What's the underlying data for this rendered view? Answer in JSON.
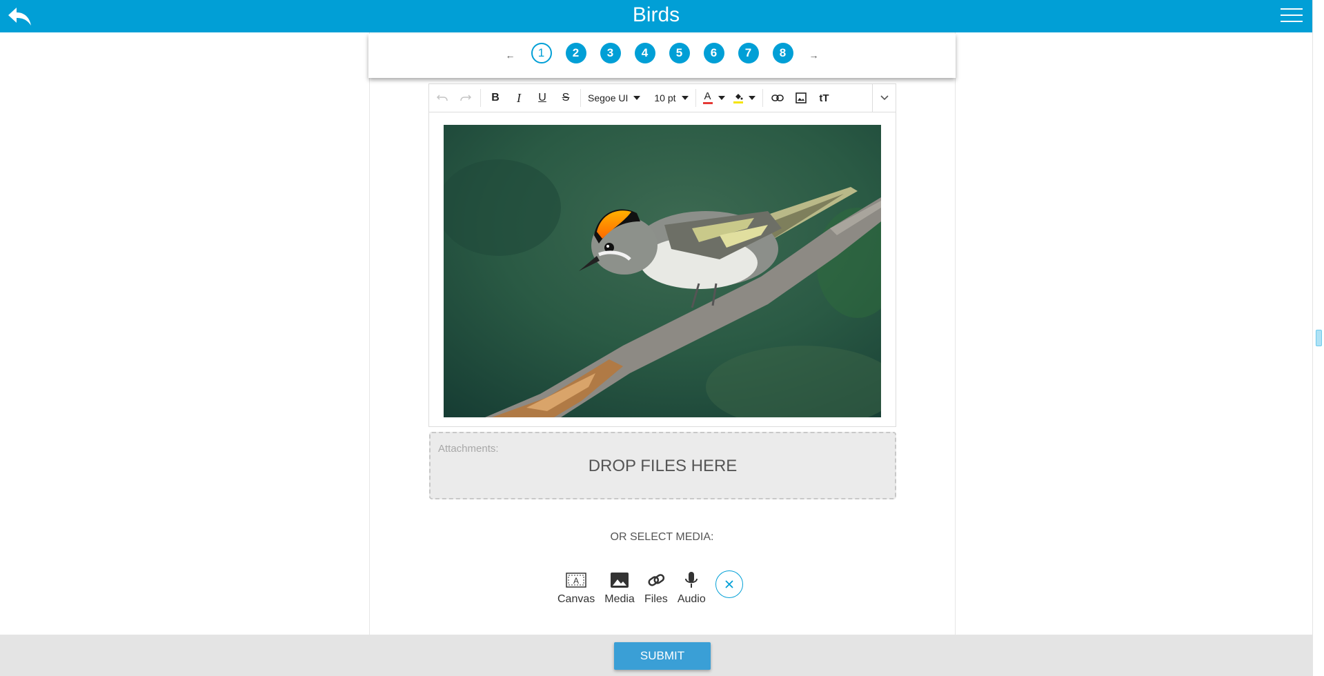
{
  "header": {
    "title": "Birds",
    "back_icon": "back-arrow-icon",
    "menu_icon": "hamburger-menu-icon"
  },
  "pager": {
    "prev": "←",
    "next": "→",
    "pages": [
      "1",
      "2",
      "3",
      "4",
      "5",
      "6",
      "7",
      "8"
    ],
    "current": "1"
  },
  "toolbar": {
    "font_family": "Segoe UI",
    "font_size": "10 pt",
    "text_color": "#e53935",
    "highlight_color": "#f5e400"
  },
  "content": {
    "image_subject": "bird on branch"
  },
  "dropzone": {
    "label": "Attachments:",
    "message": "DROP FILES HERE"
  },
  "media": {
    "heading": "OR SELECT MEDIA:",
    "items": [
      {
        "label": "Canvas",
        "icon": "canvas-icon"
      },
      {
        "label": "Media",
        "icon": "image-icon"
      },
      {
        "label": "Files",
        "icon": "link-icon"
      },
      {
        "label": "Audio",
        "icon": "microphone-icon"
      }
    ],
    "close_icon": "close-icon"
  },
  "footer": {
    "submit_label": "SUBMIT"
  },
  "colors": {
    "accent": "#019fd6",
    "footer_bg": "#e4e4e4",
    "submit_bg": "#3a9fd6"
  }
}
